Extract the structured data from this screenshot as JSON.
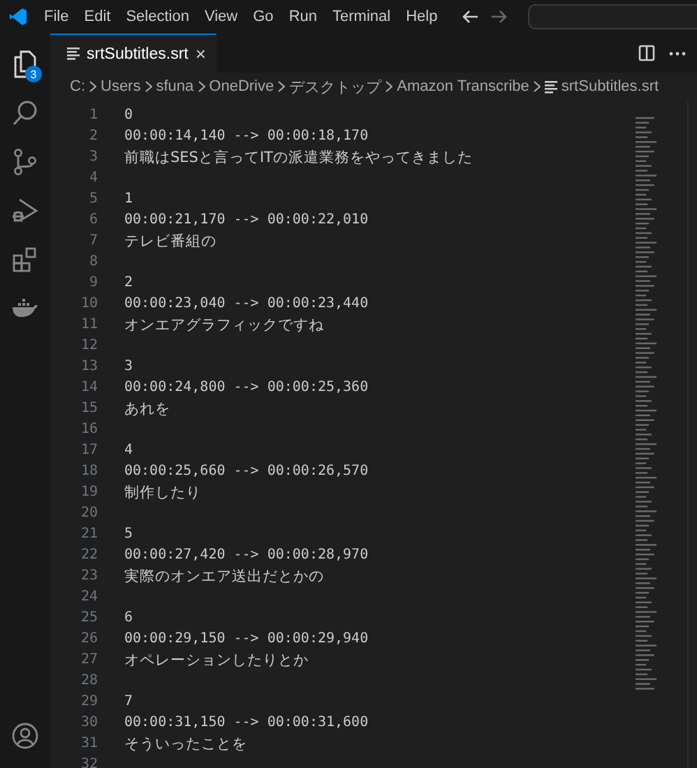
{
  "menu": [
    "File",
    "Edit",
    "Selection",
    "View",
    "Go",
    "Run",
    "Terminal",
    "Help"
  ],
  "activity": [
    {
      "kind": "explorer",
      "badge": "3",
      "selected": true
    },
    {
      "kind": "search",
      "selected": false
    },
    {
      "kind": "source-control",
      "selected": false
    },
    {
      "kind": "debug",
      "selected": false
    },
    {
      "kind": "extensions",
      "selected": false
    },
    {
      "kind": "docker",
      "selected": false
    }
  ],
  "tabs": [
    {
      "label": "srtSubtitles.srt",
      "selected": true,
      "close": "×"
    }
  ],
  "breadcrumb": [
    "C:",
    "Users",
    "sfuna",
    "OneDrive",
    "デスクトップ",
    "Amazon Transcribe",
    "srtSubtitles.srt"
  ],
  "lines": [
    {
      "number": "1",
      "text": "0"
    },
    {
      "number": "2",
      "text": "00:00:14,140 --> 00:00:18,170"
    },
    {
      "number": "3",
      "text": "前職はSESと言ってITの派遣業務をやってきました"
    },
    {
      "number": "4"
    },
    {
      "number": "5",
      "text": "1"
    },
    {
      "number": "6",
      "text": "00:00:21,170 --> 00:00:22,010"
    },
    {
      "number": "7",
      "text": "テレビ番組の"
    },
    {
      "number": "8"
    },
    {
      "number": "9",
      "text": "2"
    },
    {
      "number": "10",
      "text": "00:00:23,040 --> 00:00:23,440"
    },
    {
      "number": "11",
      "text": "オンエアグラフィックですね"
    },
    {
      "number": "12"
    },
    {
      "number": "13",
      "text": "3"
    },
    {
      "number": "14",
      "text": "00:00:24,800 --> 00:00:25,360"
    },
    {
      "number": "15",
      "text": "あれを"
    },
    {
      "number": "16"
    },
    {
      "number": "17",
      "text": "4"
    },
    {
      "number": "18",
      "text": "00:00:25,660 --> 00:00:26,570"
    },
    {
      "number": "19",
      "text": "制作したり"
    },
    {
      "number": "20"
    },
    {
      "number": "21",
      "text": "5"
    },
    {
      "number": "22",
      "text": "00:00:27,420 --> 00:00:28,970"
    },
    {
      "number": "23",
      "text": "実際のオンエア送出だとかの"
    },
    {
      "number": "24"
    },
    {
      "number": "25",
      "text": "6"
    },
    {
      "number": "26",
      "text": "00:00:29,150 --> 00:00:29,940"
    },
    {
      "number": "27",
      "text": "オペレーションしたりとか"
    },
    {
      "number": "28"
    },
    {
      "number": "29",
      "text": "7"
    },
    {
      "number": "30",
      "text": "00:00:31,150 --> 00:00:31,600"
    },
    {
      "number": "31",
      "text": "そういったことを"
    },
    {
      "number": "32"
    }
  ]
}
